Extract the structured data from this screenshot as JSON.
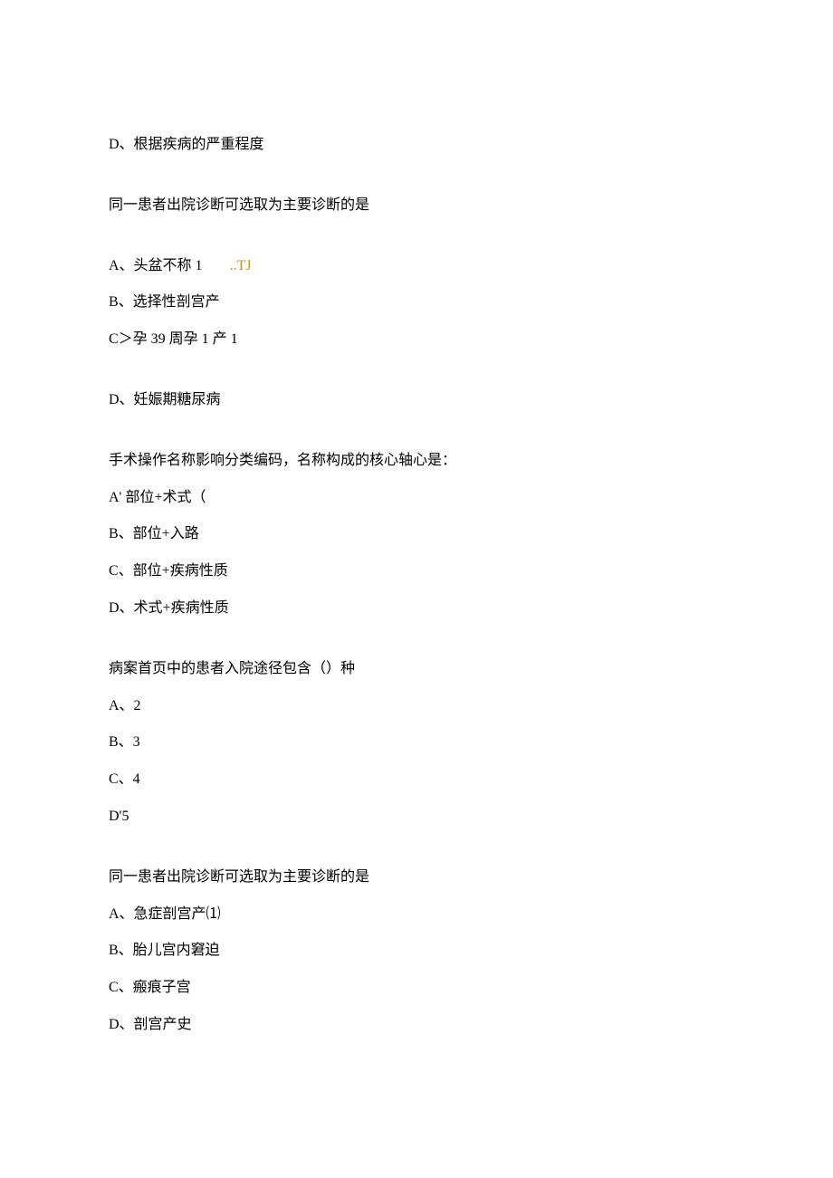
{
  "lines": {
    "l1": "D、根据疾病的严重程度",
    "q1": "同一患者出院诊断可选取为主要诊断的是",
    "q1a_cn": "A、头盆不称 1",
    "q1a_orange": "..TJ",
    "q1b": "B、选择性剖宫产",
    "q1c": "C＞孕 39 周孕 1 产 1",
    "q1d": "D、妊娠期糖尿病",
    "q2": "手术操作名称影响分类编码，名称构成的核心轴心是：",
    "q2a": "A' 部位+术式（",
    "q2b": "B、部位+入路",
    "q2c": "C、部位+疾病性质",
    "q2d": "D、术式+疾病性质",
    "q3": "病案首页中的患者入院途径包含（）种",
    "q3a": "A、2",
    "q3b": "B、3",
    "q3c": "C、4",
    "q3d": "D'5",
    "q4": "同一患者出院诊断可选取为主要诊断的是",
    "q4a": "A、急症剖宫产⑴",
    "q4b": "B、胎儿宫内窘迫",
    "q4c": "C、瘢痕子宫",
    "q4d": "D、剖宫产史"
  }
}
